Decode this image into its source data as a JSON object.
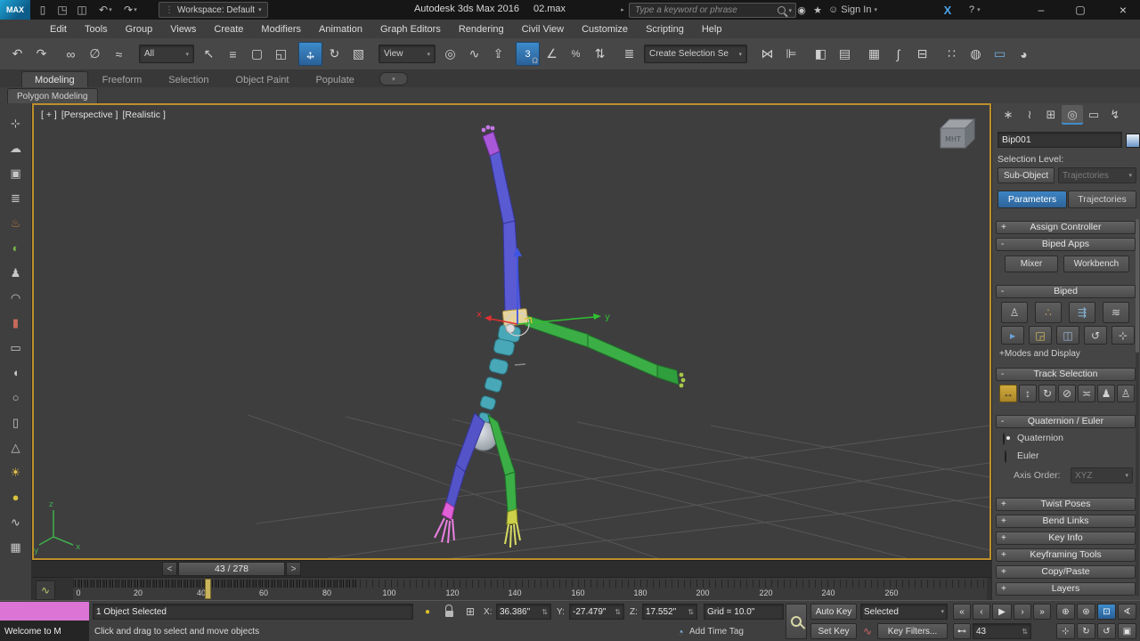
{
  "titlebar": {
    "app_title": "Autodesk 3ds Max 2016",
    "file_name": "02.max",
    "workspace": "Workspace: Default",
    "search_placeholder": "Type a keyword or phrase",
    "signin": "Sign In"
  },
  "menubar": {
    "items": [
      "Edit",
      "Tools",
      "Group",
      "Views",
      "Create",
      "Modifiers",
      "Animation",
      "Graph Editors",
      "Rendering",
      "Civil View",
      "Customize",
      "Scripting",
      "Help"
    ]
  },
  "toolbar": {
    "filter_value": "All",
    "coord_value": "View",
    "selection_set_value": "Create Selection Se",
    "snap_value": "3"
  },
  "ribbon": {
    "tabs": [
      "Modeling",
      "Freeform",
      "Selection",
      "Object Paint",
      "Populate"
    ],
    "subtab": "Polygon Modeling"
  },
  "viewport": {
    "label_plus": "[ + ]",
    "label_view": "[Perspective ]",
    "label_shading": "[Realistic ]",
    "viewcube": "MHT",
    "axis_x": "x",
    "axis_y": "y",
    "world_z": "z",
    "world_x": "x",
    "world_y": "y"
  },
  "timeslider": {
    "value": "43 / 278",
    "prev": "<",
    "next": ">"
  },
  "trackbar": {
    "numbers": [
      "0",
      "20",
      "40",
      "60",
      "80",
      "100",
      "120",
      "140",
      "160",
      "180",
      "200",
      "220",
      "240",
      "260"
    ]
  },
  "statusbar": {
    "selected": "1 Object Selected",
    "prompt": "Click and drag to select and move objects",
    "listener": "Welcome to M",
    "x_label": "X:",
    "y_label": "Y:",
    "z_label": "Z:",
    "x_value": "36.386\"",
    "y_value": "-27.479\"",
    "z_value": "17.552\"",
    "grid": "Grid = 10.0\"",
    "add_time_tag": "Add Time Tag"
  },
  "animation": {
    "auto_key": "Auto Key",
    "set_key": "Set Key",
    "selected_filter": "Selected",
    "key_filters": "Key Filters...",
    "frame": "43"
  },
  "command_panel": {
    "object_name": "Bip001",
    "selection_level": "Selection Level:",
    "sub_object": "Sub-Object",
    "sub_object_mode": "Trajectories",
    "tab_parameters": "Parameters",
    "tab_trajectories": "Trajectories",
    "mixer": "Mixer",
    "workbench": "Workbench",
    "modes_display": "+Modes and Display",
    "quaternion": "Quaternion",
    "euler": "Euler",
    "axis_order": "Axis Order:",
    "axis_value": "XYZ",
    "rollouts": {
      "assign_controller": {
        "state": "+",
        "label": "Assign Controller"
      },
      "biped_apps": {
        "state": "-",
        "label": "Biped Apps"
      },
      "biped": {
        "state": "-",
        "label": "Biped"
      },
      "track_selection": {
        "state": "-",
        "label": "Track Selection"
      },
      "quaternion_euler": {
        "state": "-",
        "label": "Quaternion / Euler"
      },
      "twist_poses": {
        "state": "+",
        "label": "Twist Poses"
      },
      "bend_links": {
        "state": "+",
        "label": "Bend Links"
      },
      "key_info": {
        "state": "+",
        "label": "Key Info"
      },
      "keyframing_tools": {
        "state": "+",
        "label": "Keyframing Tools"
      },
      "copy_paste": {
        "state": "+",
        "label": "Copy/Paste"
      },
      "layers": {
        "state": "+",
        "label": "Layers"
      }
    }
  },
  "icons": {
    "max_logo": "MAX",
    "new": "▯",
    "open": "◳",
    "save": "◫",
    "undo": "↶",
    "redo": "↷",
    "caret": "▾",
    "caret_left": "◂",
    "caret_right": "▸",
    "grip": "⋮",
    "comm": "◉",
    "star": "★",
    "user": "☺",
    "exchange": "X",
    "help": "?",
    "minimize": "–",
    "maximize": "▢",
    "close": "×",
    "link": "∞",
    "unlink": "∅",
    "bind": "≈",
    "select": "↖",
    "by_name": "≡",
    "region": "▢",
    "wincross": "◱",
    "move_h": "↔",
    "move_v": "↕",
    "rotate": "↻",
    "scale": "▧",
    "pivot": "◎",
    "manipulate": "∿",
    "kbd": "⇪",
    "snap_magnet": "Ω",
    "angle": "∠",
    "percent": "%",
    "spinner": "⇅",
    "sel_sets": "≣",
    "mirror": "⋈",
    "align": "⊫",
    "scene_explorer": "◧",
    "layer_explorer": "▤",
    "ribbon_tog": "▦",
    "curve": "∫",
    "schematic": "⊟",
    "material": "∷",
    "render_setup": "◍",
    "rfw": "▭",
    "render": "◕",
    "create": "∗",
    "modify": "≀",
    "hierarchy": "⊞",
    "motion": "◎",
    "display": "▭",
    "utilities": "↯",
    "figure": "♙",
    "footstep": "∴",
    "motion_flow": "⇶",
    "mixer_mode": "≋",
    "biped_play": "▸",
    "biped_load": "◲",
    "biped_save": "◫",
    "biped_convert": "↺",
    "move_all": "⊹",
    "body_h": "↔",
    "body_v": "↕",
    "body_rot": "↻",
    "lock_com": "⊘",
    "sym": "≍",
    "sel_sym": "♟",
    "sel_opp": "♙",
    "pb_start": "«",
    "pb_prev": "‹",
    "pb_play": "▶",
    "pb_next": "›",
    "pb_end": "»",
    "key_mode": "⊷",
    "wave": "∿",
    "offset_mode": "⊞",
    "isolate": "●",
    "zoom": "⊕",
    "zoom_all": "⊛",
    "zoom_ext": "⊡",
    "fov": "∢",
    "pan": "⊹",
    "orbit": "↻",
    "roll": "↺",
    "max_vp": "▣",
    "mini_curve": "∿",
    "clock": "◔",
    "left": [
      "⊹",
      "☁",
      "▣",
      "≣",
      "♨",
      "◐",
      "♟",
      "◠",
      "▮",
      "▭",
      "◖",
      "○",
      "▯",
      "△",
      "☀",
      "●",
      "∿",
      "▦"
    ]
  }
}
